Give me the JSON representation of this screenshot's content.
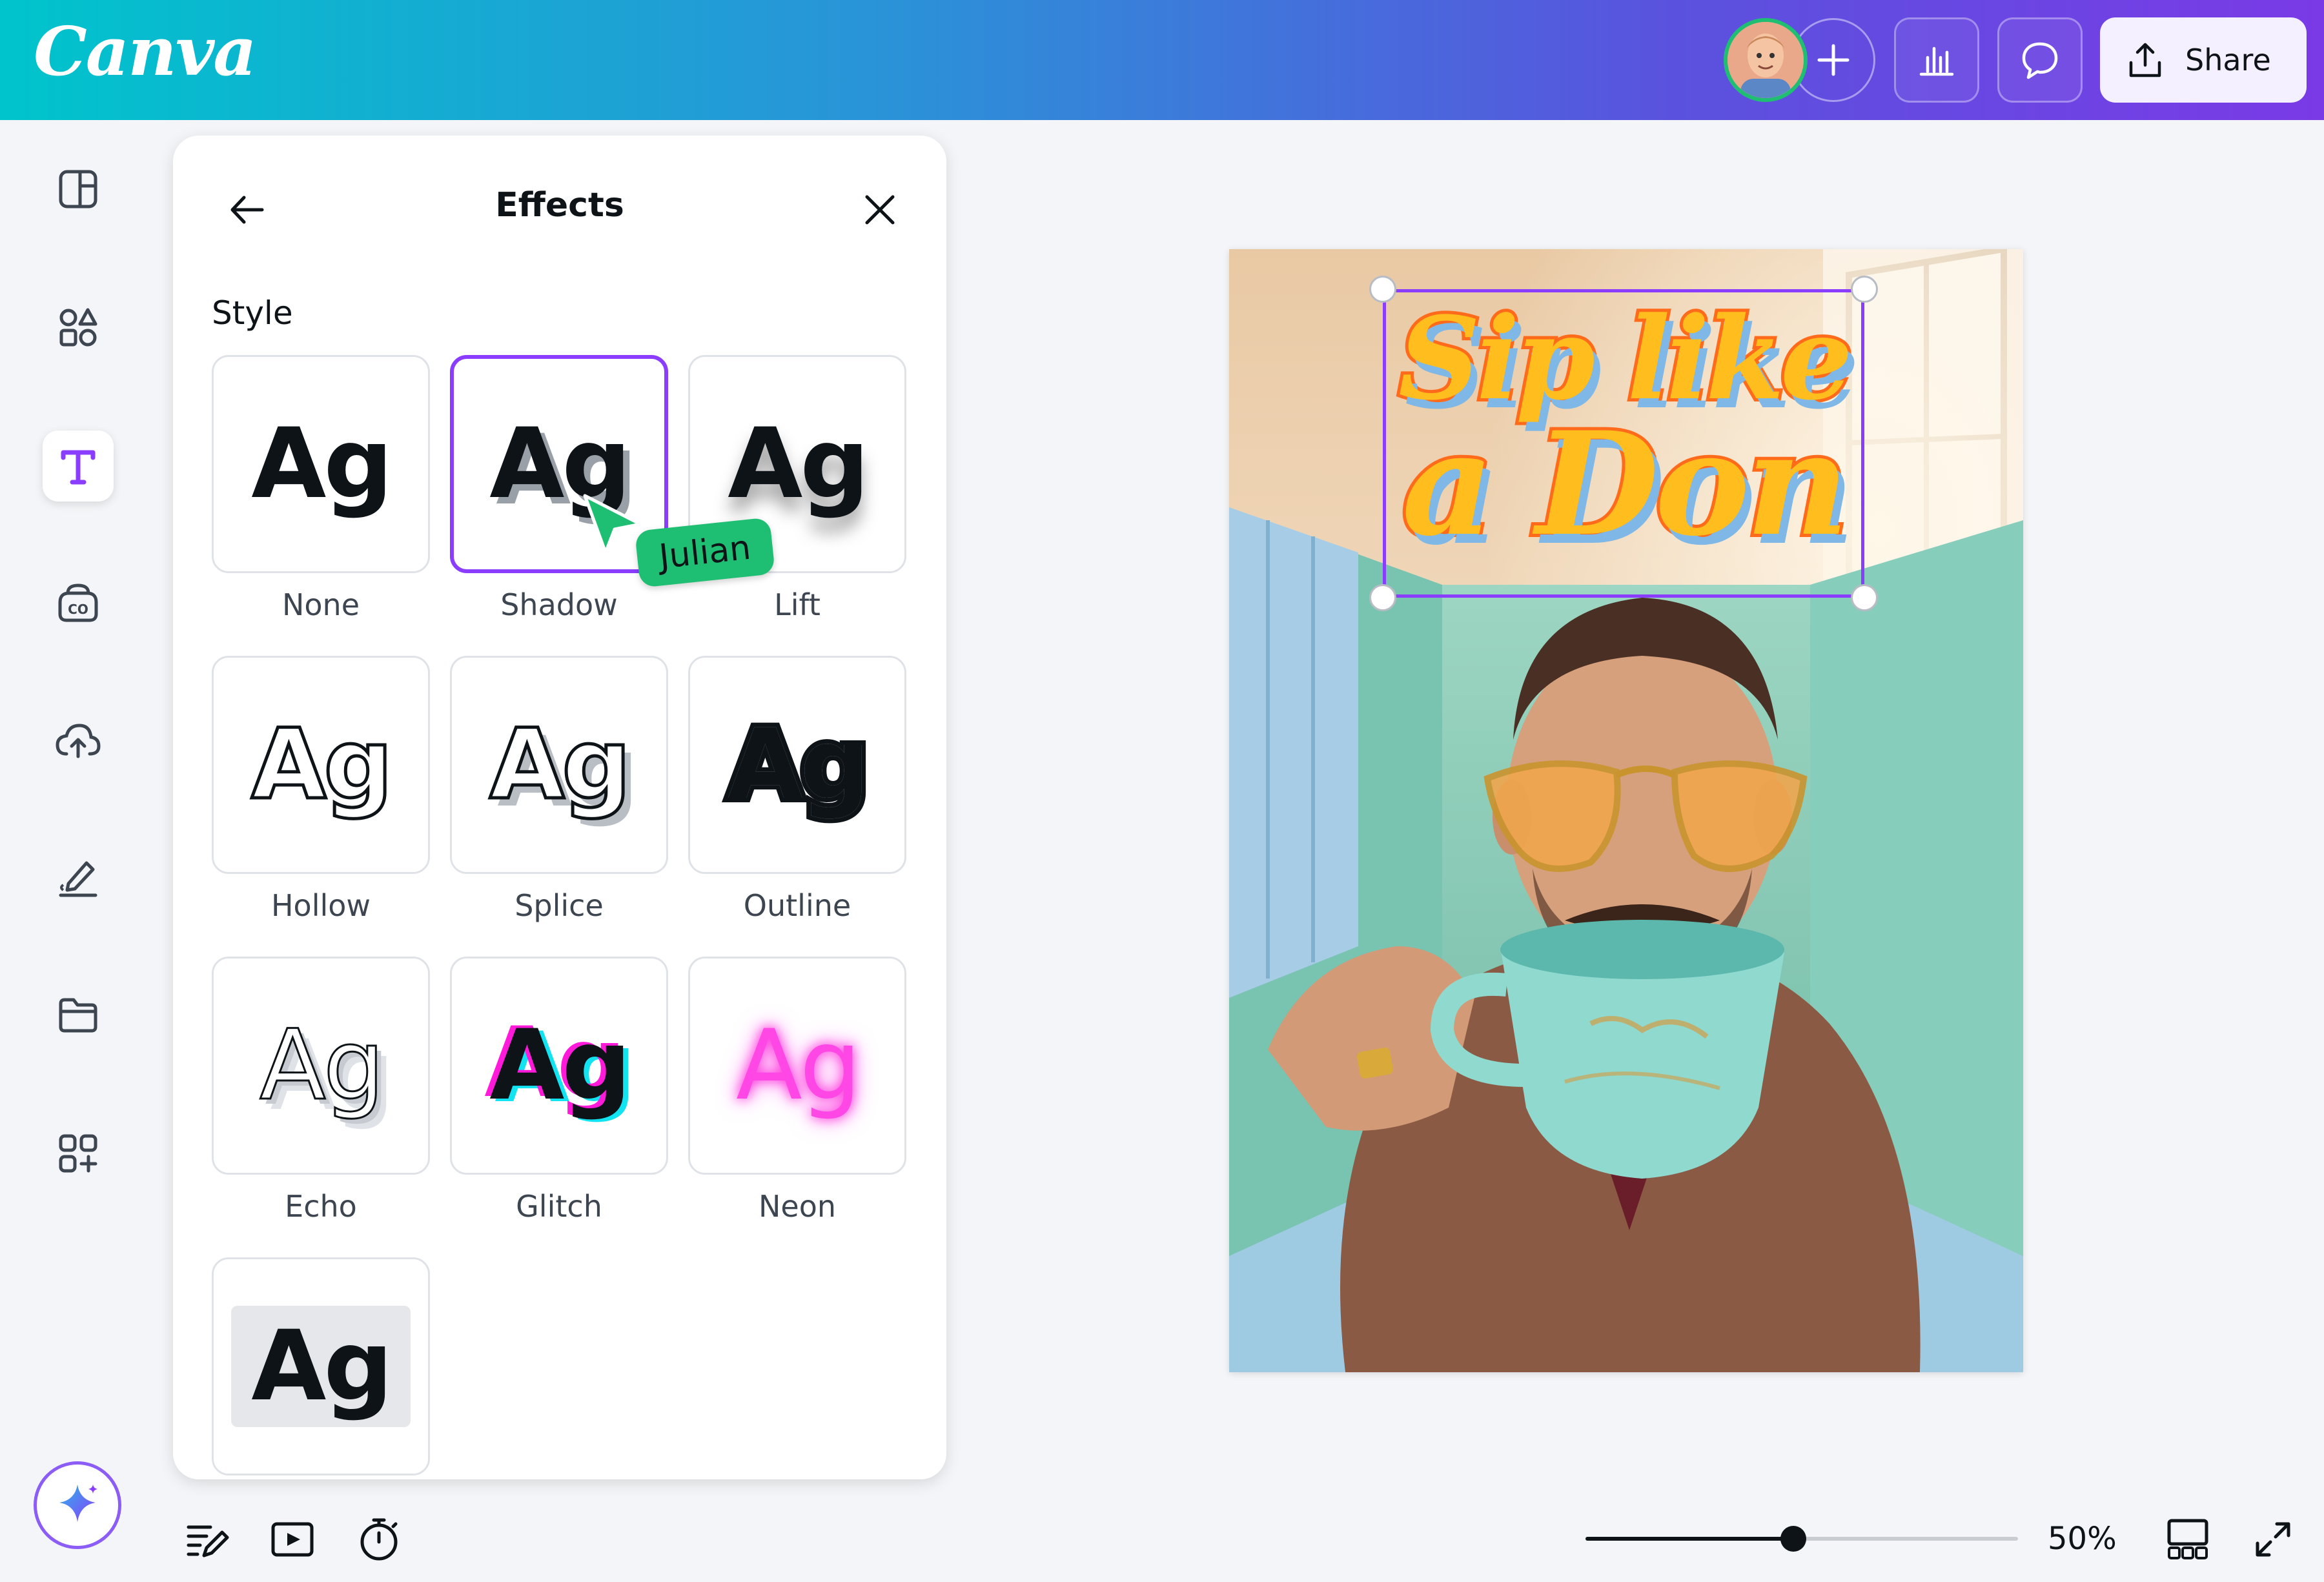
{
  "app": {
    "logo": "Canva"
  },
  "topbar": {
    "share_label": "Share",
    "icons": [
      "plus-icon",
      "analytics-icon",
      "comment-icon",
      "share-upload-icon"
    ]
  },
  "rail": {
    "items": [
      "design-icon",
      "elements-icon",
      "text-icon",
      "brand-icon",
      "uploads-icon",
      "draw-icon",
      "projects-icon",
      "apps-icon"
    ],
    "active": "text-icon",
    "magic": "magic-sparkle-icon"
  },
  "panel": {
    "title": "Effects",
    "section_label": "Style",
    "selected": "Shadow",
    "styles": [
      {
        "label": "None",
        "sample": "Ag"
      },
      {
        "label": "Shadow",
        "sample": "Ag"
      },
      {
        "label": "Lift",
        "sample": "Ag"
      },
      {
        "label": "Hollow",
        "sample": "Ag"
      },
      {
        "label": "Splice",
        "sample": "Ag"
      },
      {
        "label": "Outline",
        "sample": "Ag"
      },
      {
        "label": "Echo",
        "sample": "Ag"
      },
      {
        "label": "Glitch",
        "sample": "Ag"
      },
      {
        "label": "Neon",
        "sample": "Ag"
      },
      {
        "label": "",
        "sample": "Ag"
      }
    ]
  },
  "collaborator": {
    "name": "Julian",
    "color": "#1fbf73"
  },
  "design": {
    "headline_line1": "Sip like",
    "headline_line2": "a Don",
    "colors": {
      "fill": "#ffbe1e",
      "stroke": "#ff6b1a",
      "shadow": "#7fb7e6"
    }
  },
  "bottombar": {
    "zoom_label": "50%",
    "zoom_fraction": 0.48,
    "icons": [
      "notes-icon",
      "present-icon",
      "timer-icon",
      "grid-view-icon",
      "fullscreen-icon"
    ]
  },
  "colors": {
    "accent": "#8b3dff",
    "selection": "#8b3dff"
  }
}
